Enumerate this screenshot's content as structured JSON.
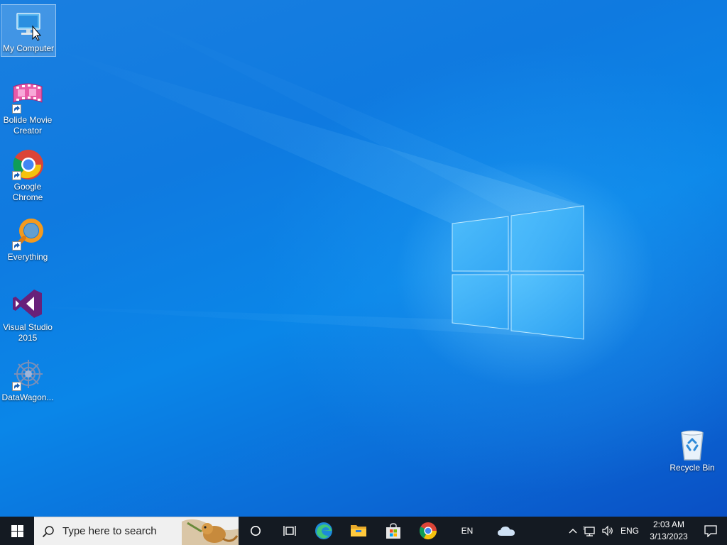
{
  "desktop": {
    "icons": [
      {
        "label": "My Computer",
        "icon": "monitor-icon",
        "selected": true
      },
      {
        "label": "Bolide Movie Creator",
        "icon": "film-strip-icon"
      },
      {
        "label": "Google Chrome",
        "icon": "chrome-icon"
      },
      {
        "label": "Everything",
        "icon": "magnifier-icon"
      },
      {
        "label": "Visual Studio 2015",
        "icon": "visual-studio-icon"
      },
      {
        "label": "DataWagon...",
        "icon": "gear-network-icon"
      }
    ],
    "recycle_bin": {
      "label": "Recycle Bin",
      "icon": "recycle-bin-icon"
    }
  },
  "taskbar": {
    "start": {
      "icon": "windows-logo-icon"
    },
    "search": {
      "placeholder": "Type here to search",
      "icon": "search-icon"
    },
    "buttons": [
      {
        "name": "cortana",
        "icon": "cortana-circle-icon"
      },
      {
        "name": "task-view",
        "icon": "task-view-icon"
      },
      {
        "name": "edge",
        "icon": "edge-icon"
      },
      {
        "name": "file-explorer",
        "icon": "folder-icon"
      },
      {
        "name": "microsoft-store",
        "icon": "store-bag-icon"
      },
      {
        "name": "chrome",
        "icon": "chrome-icon"
      }
    ],
    "input_indicator": "EN",
    "tray": {
      "onedrive_icon": "cloud-icon",
      "chevron_icon": "chevron-up-icon",
      "network_icon": "network-icon",
      "volume_icon": "speaker-icon",
      "language": "ENG",
      "time": "2:03 AM",
      "date": "3/13/2023",
      "notification_icon": "notification-icon"
    }
  },
  "colors": {
    "taskbar": "#141a22",
    "wallpaper_blue": "#0a72d8",
    "search_box": "#f0f0f0"
  }
}
